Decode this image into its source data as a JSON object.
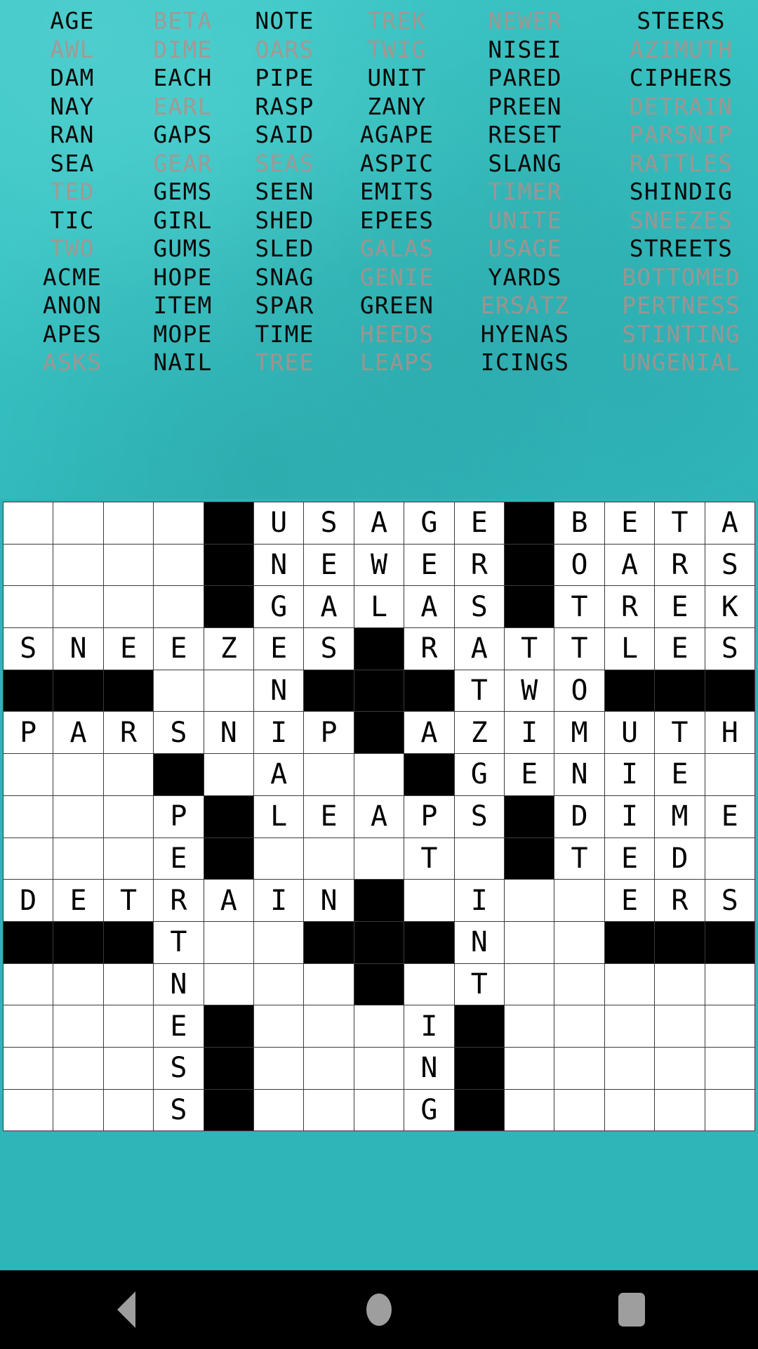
{
  "theme": {
    "background_teal": "#33bdbf",
    "found_word_color": "#0a0a0a",
    "pending_word_color": "#b98d88",
    "grid_block_color": "#000000",
    "grid_cell_color": "#ffffff"
  },
  "word_bank": {
    "columns": 6,
    "rows": [
      [
        {
          "text": "AGE",
          "found": true
        },
        {
          "text": "BETA",
          "found": false
        },
        {
          "text": "NOTE",
          "found": true
        },
        {
          "text": "TREK",
          "found": false
        },
        {
          "text": "NEWER",
          "found": false
        },
        {
          "text": "STEERS",
          "found": true
        }
      ],
      [
        {
          "text": "AWL",
          "found": false
        },
        {
          "text": "DIME",
          "found": false
        },
        {
          "text": "OARS",
          "found": false
        },
        {
          "text": "TWIG",
          "found": false
        },
        {
          "text": "NISEI",
          "found": true
        },
        {
          "text": "AZIMUTH",
          "found": false
        }
      ],
      [
        {
          "text": "DAM",
          "found": true
        },
        {
          "text": "EACH",
          "found": true
        },
        {
          "text": "PIPE",
          "found": true
        },
        {
          "text": "UNIT",
          "found": true
        },
        {
          "text": "PARED",
          "found": true
        },
        {
          "text": "CIPHERS",
          "found": true
        }
      ],
      [
        {
          "text": "NAY",
          "found": true
        },
        {
          "text": "EARL",
          "found": false
        },
        {
          "text": "RASP",
          "found": true
        },
        {
          "text": "ZANY",
          "found": true
        },
        {
          "text": "PREEN",
          "found": true
        },
        {
          "text": "DETRAIN",
          "found": false
        }
      ],
      [
        {
          "text": "RAN",
          "found": true
        },
        {
          "text": "GAPS",
          "found": true
        },
        {
          "text": "SAID",
          "found": true
        },
        {
          "text": "AGAPE",
          "found": true
        },
        {
          "text": "RESET",
          "found": true
        },
        {
          "text": "PARSNIP",
          "found": false
        }
      ],
      [
        {
          "text": "SEA",
          "found": true
        },
        {
          "text": "GEAR",
          "found": false
        },
        {
          "text": "SEAS",
          "found": false
        },
        {
          "text": "ASPIC",
          "found": true
        },
        {
          "text": "SLANG",
          "found": true
        },
        {
          "text": "RATTLES",
          "found": false
        }
      ],
      [
        {
          "text": "TED",
          "found": false
        },
        {
          "text": "GEMS",
          "found": true
        },
        {
          "text": "SEEN",
          "found": true
        },
        {
          "text": "EMITS",
          "found": true
        },
        {
          "text": "TIMER",
          "found": false
        },
        {
          "text": "SHINDIG",
          "found": true
        }
      ],
      [
        {
          "text": "TIC",
          "found": true
        },
        {
          "text": "GIRL",
          "found": true
        },
        {
          "text": "SHED",
          "found": true
        },
        {
          "text": "EPEES",
          "found": true
        },
        {
          "text": "UNITE",
          "found": false
        },
        {
          "text": "SNEEZES",
          "found": false
        }
      ],
      [
        {
          "text": "TWO",
          "found": false
        },
        {
          "text": "GUMS",
          "found": true
        },
        {
          "text": "SLED",
          "found": true
        },
        {
          "text": "GALAS",
          "found": false
        },
        {
          "text": "USAGE",
          "found": false
        },
        {
          "text": "STREETS",
          "found": true
        }
      ],
      [
        {
          "text": "ACME",
          "found": true
        },
        {
          "text": "HOPE",
          "found": true
        },
        {
          "text": "SNAG",
          "found": true
        },
        {
          "text": "GENIE",
          "found": false
        },
        {
          "text": "YARDS",
          "found": true
        },
        {
          "text": "BOTTOMED",
          "found": false
        }
      ],
      [
        {
          "text": "ANON",
          "found": true
        },
        {
          "text": "ITEM",
          "found": true
        },
        {
          "text": "SPAR",
          "found": true
        },
        {
          "text": "GREEN",
          "found": true
        },
        {
          "text": "ERSATZ",
          "found": false
        },
        {
          "text": "PERTNESS",
          "found": false
        }
      ],
      [
        {
          "text": "APES",
          "found": true
        },
        {
          "text": "MOPE",
          "found": true
        },
        {
          "text": "TIME",
          "found": true
        },
        {
          "text": "HEEDS",
          "found": false
        },
        {
          "text": "HYENAS",
          "found": true
        },
        {
          "text": "STINTING",
          "found": false
        }
      ],
      [
        {
          "text": "ASKS",
          "found": false
        },
        {
          "text": "NAIL",
          "found": true
        },
        {
          "text": "TREE",
          "found": false
        },
        {
          "text": "LEAPS",
          "found": false
        },
        {
          "text": "ICINGS",
          "found": true
        },
        {
          "text": "UNGENIAL",
          "found": false
        }
      ]
    ]
  },
  "crossword": {
    "columns": 15,
    "rows": 17,
    "legend": {
      "#": "block",
      ".": "empty",
      "A-Z": "filled letter"
    },
    "grid": [
      "....#USAGE#BETA",
      "....#NEWER#OARS",
      "....#GALAS#TREK",
      "SNEEZES#RATTLES",
      "###..N###TWO###",
      "PARSNIP#AZIMUTH",
      "...#.A..#GENIE.",
      "...P#LEAPS#DIME",
      "...E#...T.#TED.",
      "DETRAIN#.I..ERS",
      "###T..###N..###",
      "...N...#.T.....",
      "...E#...I#.....",
      "...S#...N#.....",
      "...S#...G#....."
    ]
  },
  "navbar": {
    "back_label": "back-button",
    "home_label": "home-button",
    "recents_label": "recents-button"
  }
}
